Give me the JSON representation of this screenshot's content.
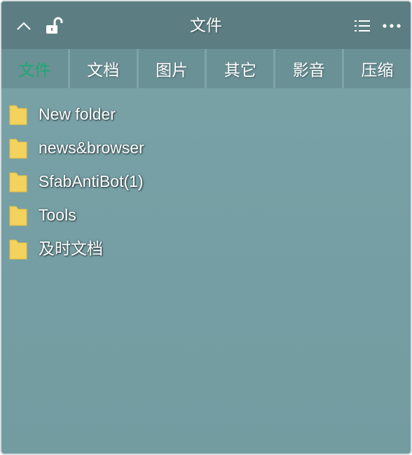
{
  "header": {
    "title": "文件",
    "collapse_icon": "chevron-up-icon",
    "lock_icon": "unlock-icon",
    "list_icon": "list-view-icon",
    "more_icon": "more-icon"
  },
  "tabs": [
    {
      "label": "文件",
      "active": true
    },
    {
      "label": "文档",
      "active": false
    },
    {
      "label": "图片",
      "active": false
    },
    {
      "label": "其它",
      "active": false
    },
    {
      "label": "影音",
      "active": false
    },
    {
      "label": "压缩",
      "active": false
    }
  ],
  "files": [
    {
      "name": "New folder",
      "icon": "folder-icon"
    },
    {
      "name": "news&browser",
      "icon": "folder-icon"
    },
    {
      "name": "SfabAntiBot(1)",
      "icon": "folder-icon"
    },
    {
      "name": "Tools",
      "icon": "folder-icon"
    },
    {
      "name": "及时文档",
      "icon": "folder-icon"
    }
  ],
  "colors": {
    "active_tab": "#1ea86d",
    "folder": "#f3d25e",
    "panel_bg": "#76a0a5"
  }
}
